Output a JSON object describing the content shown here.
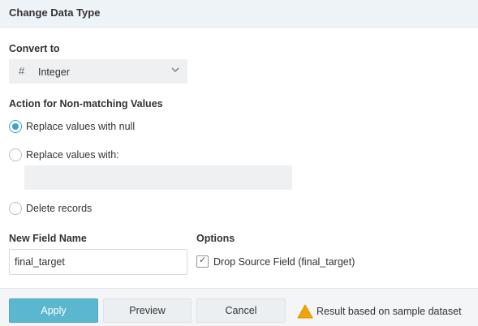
{
  "header": {
    "title": "Change Data Type"
  },
  "convert": {
    "label": "Convert to",
    "type_icon": "hash-icon",
    "selected": "Integer"
  },
  "action": {
    "label": "Action for Non-matching Values",
    "options": [
      {
        "label": "Replace values with null",
        "checked": true
      },
      {
        "label": "Replace values with:",
        "checked": false
      },
      {
        "label": "Delete records",
        "checked": false
      }
    ],
    "replace_value": ""
  },
  "new_field": {
    "label": "New Field Name",
    "value": "final_target"
  },
  "options": {
    "label": "Options",
    "drop_source": {
      "label": "Drop Source Field (final_target)",
      "checked": true
    }
  },
  "footer": {
    "apply": "Apply",
    "preview": "Preview",
    "cancel": "Cancel",
    "note": "Result based on sample dataset"
  },
  "colors": {
    "accent": "#3aa6c6",
    "apply_bg": "#5bb6cf",
    "warning": "#f0a30a"
  }
}
